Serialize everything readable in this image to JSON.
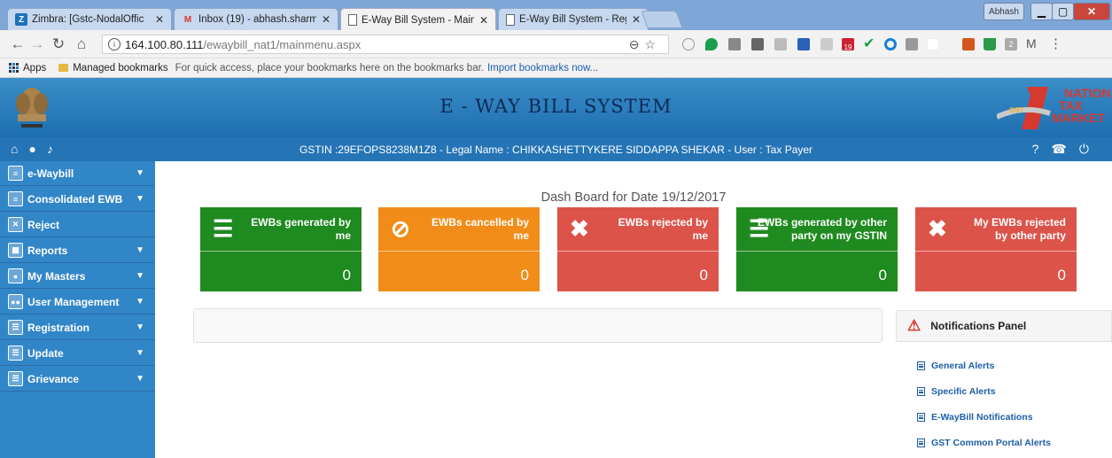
{
  "browser": {
    "tabs": [
      {
        "label": "Zimbra: [Gstc-NodalOffic",
        "favicon": "zimbra-icon"
      },
      {
        "label": "Inbox (19) - abhash.sharm",
        "favicon": "gmail-icon"
      },
      {
        "label": "E-Way Bill System - Main",
        "favicon": "page-icon",
        "active": true
      },
      {
        "label": "E-Way Bill System - Regi",
        "favicon": "page-icon"
      }
    ],
    "profile_name": "Abhash",
    "url_host": "164.100.80.111",
    "url_path": "/ewaybill_nat1/mainmenu.aspx",
    "gmail_badge": "19",
    "ext_badge": "2"
  },
  "bookmarks": {
    "apps_label": "Apps",
    "folder_label": "Managed bookmarks",
    "hint": "For quick access, place your bookmarks here on the bookmarks bar.",
    "import_link": "Import bookmarks now..."
  },
  "header": {
    "title": "E - WAY BILL SYSTEM",
    "logo_line1": "NATION",
    "logo_line2": "TAX",
    "logo_line3": "MARKET",
    "logo_gst": "GST"
  },
  "userbar": {
    "info": "GSTIN :29EFOPS8238M1Z8 - Legal Name : CHIKKASHETTYKERE SIDDAPPA SHEKAR - User : Tax Payer"
  },
  "sidebar": {
    "items": [
      {
        "label": "e-Waybill",
        "icon": "document-icon",
        "expandable": true
      },
      {
        "label": "Consolidated EWB",
        "icon": "clipboard-icon",
        "expandable": true
      },
      {
        "label": "Reject",
        "icon": "reject-icon",
        "expandable": false
      },
      {
        "label": "Reports",
        "icon": "report-icon",
        "expandable": true
      },
      {
        "label": "My Masters",
        "icon": "user-icon",
        "expandable": true
      },
      {
        "label": "User Management",
        "icon": "users-icon",
        "expandable": true
      },
      {
        "label": "Registration",
        "icon": "id-card-icon",
        "expandable": true
      },
      {
        "label": "Update",
        "icon": "id-card-icon",
        "expandable": true
      },
      {
        "label": "Grievance",
        "icon": "id-card-icon",
        "expandable": true
      }
    ]
  },
  "dashboard": {
    "title": "Dash Board for Date 19/12/2017",
    "cards": [
      {
        "label": "EWBs generated by me",
        "value": "0",
        "color": "#1f8a1f",
        "icon": "list-icon"
      },
      {
        "label": "EWBs cancelled by me",
        "value": "0",
        "color": "#f28c18",
        "icon": "ban-icon"
      },
      {
        "label": "EWBs rejected by me",
        "value": "0",
        "color": "#dc534a",
        "icon": "times-icon"
      },
      {
        "label": "EWBs generated by other party on my GSTIN",
        "value": "0",
        "color": "#1f8a1f",
        "icon": "list-icon"
      },
      {
        "label": "My EWBs rejected by other party",
        "value": "0",
        "color": "#dc534a",
        "icon": "times-icon"
      }
    ]
  },
  "notifications": {
    "title": "Notifications Panel",
    "links": [
      "General Alerts",
      "Specific Alerts",
      "E-WayBill Notifications",
      "GST Common Portal Alerts"
    ]
  }
}
